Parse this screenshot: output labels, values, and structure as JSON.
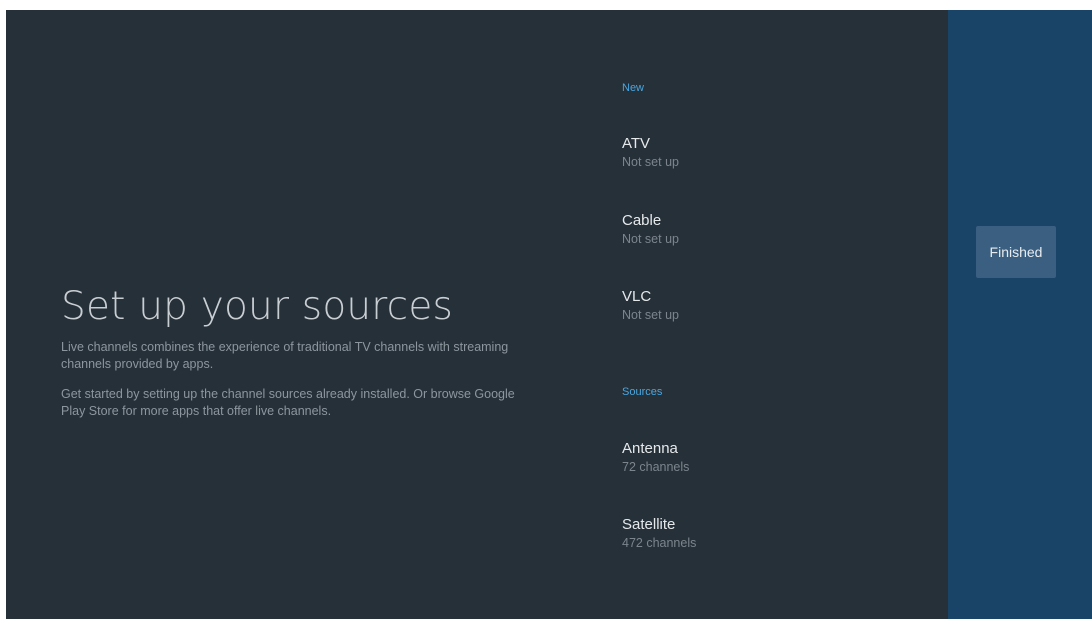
{
  "main": {
    "title": "Set up your sources",
    "description_1": "Live channels combines the experience of traditional TV channels with streaming channels provided by apps.",
    "description_2": "Get started by setting up the channel sources already installed. Or browse Google Play Store for more apps that offer live channels."
  },
  "list": {
    "new_header": "New",
    "new_items": [
      {
        "title": "ATV",
        "subtitle": "Not set up"
      },
      {
        "title": "Cable",
        "subtitle": "Not set up"
      },
      {
        "title": "VLC",
        "subtitle": "Not set up"
      }
    ],
    "sources_header": "Sources",
    "source_items": [
      {
        "title": "Antenna",
        "subtitle": "72 channels"
      },
      {
        "title": "Satellite",
        "subtitle": "472 channels"
      }
    ]
  },
  "actions": {
    "finished_label": "Finished"
  },
  "colors": {
    "background": "#263038",
    "action_panel": "#1a4368",
    "accent": "#4aa6e0"
  }
}
